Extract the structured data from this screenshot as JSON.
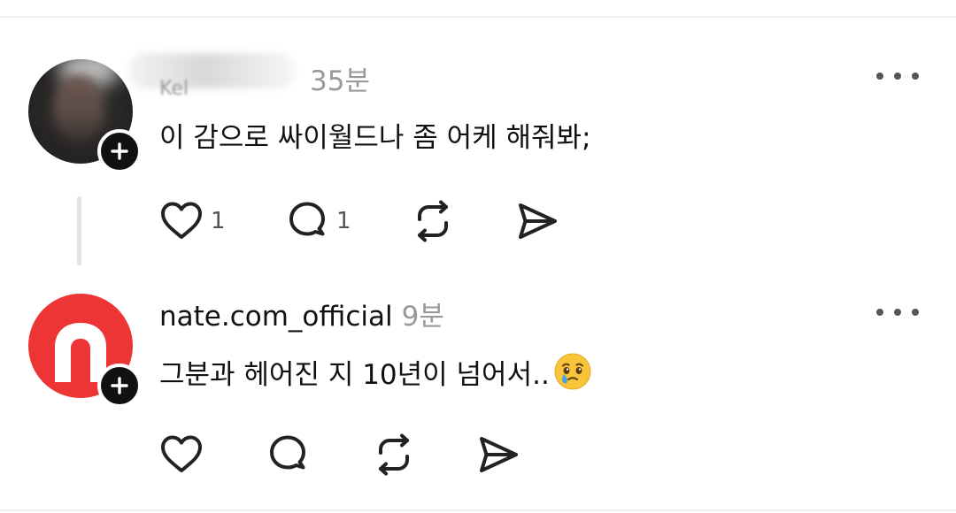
{
  "posts": [
    {
      "username": "Kel",
      "time": "35분",
      "text": "이 감으로 싸이월드나 좀 어케 해줘봐;",
      "likes": "1",
      "replies": "1"
    },
    {
      "username": "nate.com_official",
      "time": "9분",
      "text": "그분과 헤어진 지 10년이 넘어서..",
      "emoji": "face-holding-back-tears"
    }
  ],
  "colors": {
    "nate_red": "#ee3535",
    "time_gray": "#999999",
    "icon_dark": "#222222"
  },
  "icons": [
    "heart-icon",
    "comment-icon",
    "repost-icon",
    "share-icon",
    "more-icon",
    "follow-plus-icon"
  ]
}
